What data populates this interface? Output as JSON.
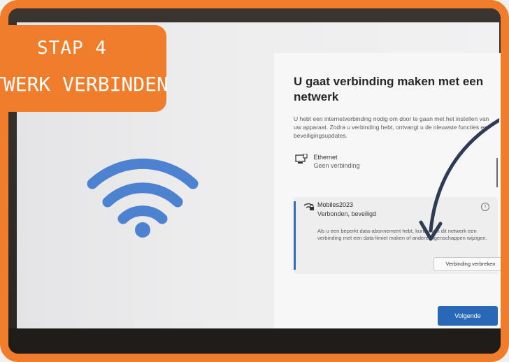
{
  "badge": {
    "line1": "STAP 4",
    "line2": "TWERK VERBINDEN"
  },
  "dialog": {
    "title": "U gaat verbinding maken met een netwerk",
    "intro": "U hebt een internetverbinding nodig om door te gaan met het instellen van uw apparaat. Zodra u verbinding hebt, ontvangt u de nieuwste functies en beveiligingsupdates.",
    "networks": [
      {
        "name": "Ethernet",
        "status": "Geen verbinding",
        "icon": "ethernet-icon"
      },
      {
        "name": "Mobiles2023",
        "status": "Verbonden, beveiligd",
        "icon": "wifi-secured-icon",
        "description": "Als u een beperkt data-abonnement hebt, kunt u van dit netwerk een verbinding met een data-limiet maken of andere eigenschappen wijzigen.",
        "disconnect_label": "Verbinding verbreken"
      }
    ],
    "next_label": "Volgende"
  },
  "colors": {
    "accent_orange": "#ef7d2c",
    "wifi_blue": "#4d82d0",
    "button_blue": "#2968b5",
    "arrow_navy": "#2d3b55"
  }
}
